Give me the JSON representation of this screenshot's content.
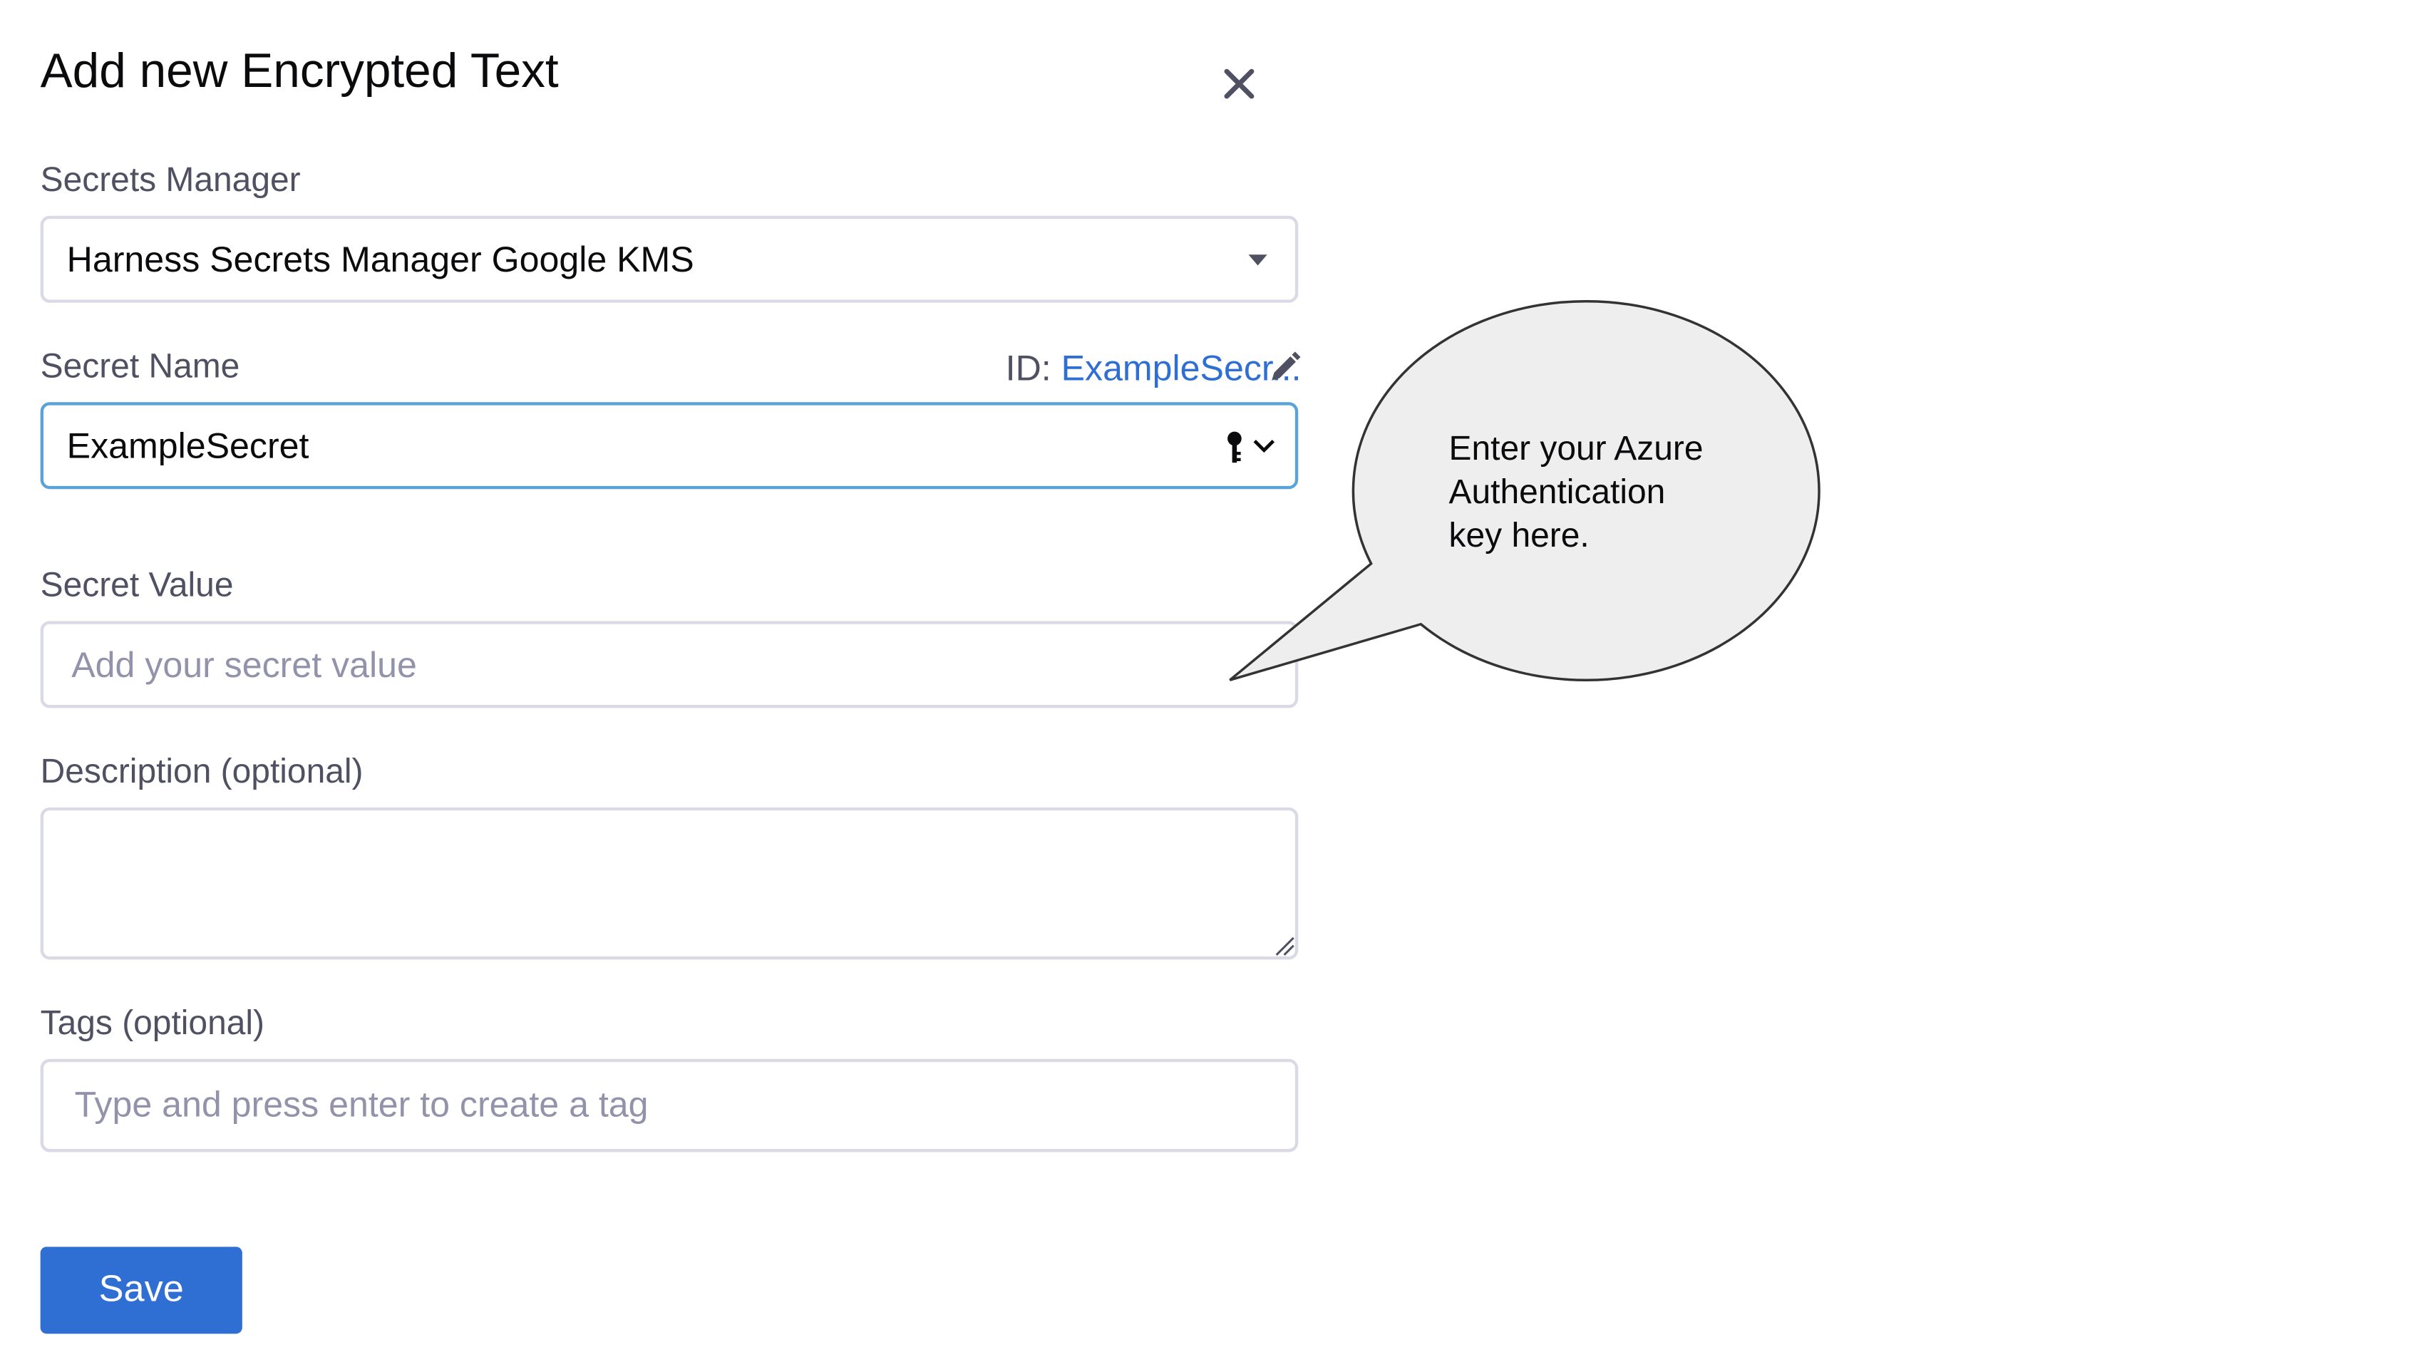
{
  "dialog": {
    "title": "Add new Encrypted Text",
    "close_icon": "close-icon"
  },
  "secrets_manager": {
    "label": "Secrets Manager",
    "value": "Harness Secrets Manager Google KMS",
    "dropdown_icon": "caret-down-icon"
  },
  "secret_name": {
    "label": "Secret Name",
    "id_label": "ID:",
    "id_value": "ExampleSecr...",
    "edit_icon": "pencil-icon",
    "value": "ExampleSecret",
    "key_icon": "key-icon",
    "chevron_icon": "chevron-down-icon"
  },
  "secret_value": {
    "label": "Secret Value",
    "placeholder": "Add your secret value"
  },
  "description": {
    "label": "Description (optional)",
    "value": "",
    "resize_icon": "resize-handle-icon"
  },
  "tags": {
    "label": "Tags (optional)",
    "placeholder": "Type and press enter to create a tag"
  },
  "save_label": "Save",
  "callout": {
    "lines": [
      "Enter your Azure",
      "Authentication",
      "key here."
    ],
    "fill": "#eeeeee",
    "stroke": "#333333"
  },
  "colors": {
    "accent": "#2f6fd4",
    "focus_border": "#5aa3d9",
    "border": "#d9dae5",
    "label": "#4f5162",
    "placeholder": "#9293ab"
  }
}
